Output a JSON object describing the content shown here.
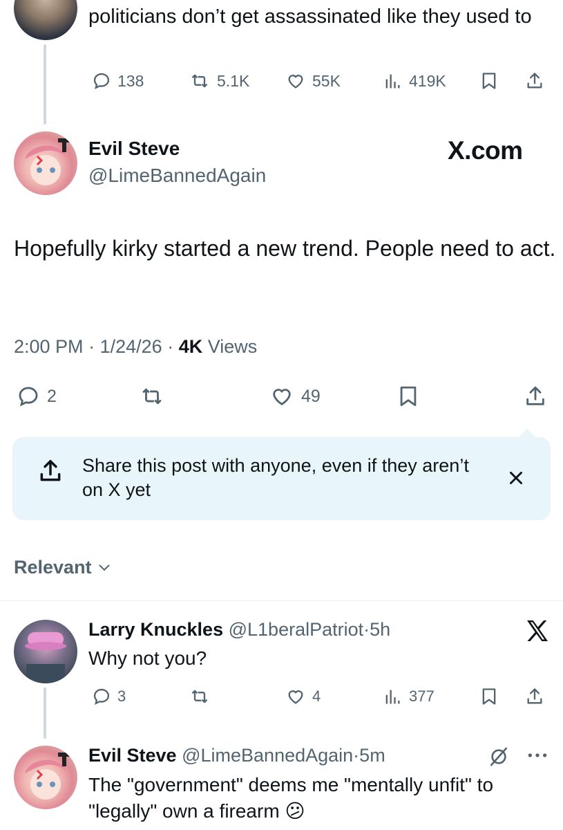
{
  "top_reply": {
    "text": "politicians don’t get assassinated like they used to",
    "actions": {
      "replies": "138",
      "reposts": "5.1K",
      "likes": "55K",
      "views": "419K"
    }
  },
  "main_post": {
    "author": "Evil Steve",
    "handle": "@LimeBannedAgain",
    "watermark": "X.com",
    "text": "Hopefully kirky started a new trend. People need to act.",
    "time": "2:00 PM",
    "date": "1/24/26",
    "views_count": "4K",
    "views_label": "Views",
    "sep": "·",
    "actions": {
      "replies": "2",
      "likes": "49"
    }
  },
  "share_prompt": {
    "text": "Share this post with anyone, even if they aren’t on X yet"
  },
  "sort": {
    "label": "Relevant"
  },
  "replies": [
    {
      "author": "Larry Knuckles",
      "handle": "@L1beralPatriot",
      "time": "5h",
      "text": "Why not you?",
      "badge": "X",
      "actions": {
        "replies": "3",
        "likes": "4",
        "views": "377"
      }
    },
    {
      "author": "Evil Steve",
      "handle": "@LimeBannedAgain",
      "time": "5m",
      "text": "The \"government\" deems me \"mentally unfit\" to \"legally\" own a firearm 😕"
    }
  ],
  "colors": {
    "accent": "#1d9bf0",
    "muted": "#536471",
    "text": "#0f1419",
    "share_bg": "#e8f5fb"
  },
  "icons": [
    "reply-icon",
    "repost-icon",
    "like-icon",
    "views-icon",
    "bookmark-icon",
    "share-icon",
    "close-icon",
    "chevron-down-icon",
    "x-logo-icon",
    "more-icon",
    "grok-icon"
  ]
}
